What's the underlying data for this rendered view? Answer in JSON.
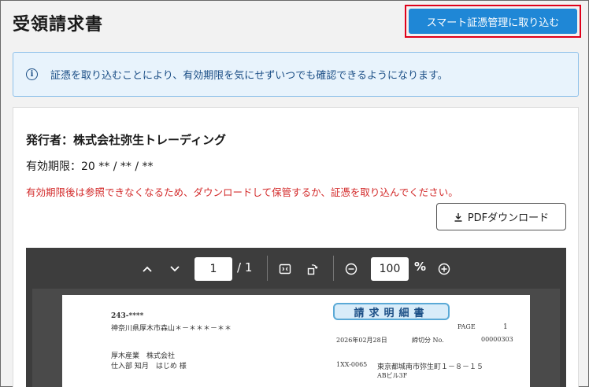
{
  "header": {
    "title": "受領請求書",
    "import_button_label": "スマート証憑管理に取り込む"
  },
  "info": {
    "icon": "info-icon",
    "text": "証憑を取り込むことにより、有効期限を気にせずいつでも確認できるようになります。"
  },
  "card": {
    "issuer": "発行者：株式会社弥生トレーディング",
    "expiry": "有効期限：20 ** / ** / **",
    "warning": "有効期限後は参照できなくなるため、ダウンロードして保管するか、証憑を取り込んでください。",
    "download_button_label": "PDFダウンロード"
  },
  "viewer": {
    "current_page": "1",
    "page_total": "/ 1",
    "zoom_value": "100",
    "zoom_unit": "%"
  },
  "document": {
    "postal_code": "243-****",
    "address": "神奈川県厚木市森山＊－＊＊＊－＊＊",
    "company": "厚木産業　株式会社",
    "recipient": "仕入部 知月　はじめ 様",
    "title": "請求明細書",
    "page_label": "PAGE",
    "page_no": "1",
    "date": "2026年02月28日",
    "closing_label": "締切分 No.",
    "doc_no": "00000303",
    "sender_code": "1XX-0065",
    "sender_address": "東京都城南市弥生町１－８－１５",
    "sender_building": "ABビル3F"
  },
  "colors": {
    "primary": "#1f87d6",
    "info_bg": "#e8f3fc",
    "info_text": "#1c4f86",
    "warning": "#d32b2b",
    "highlight_border": "#e0001a"
  }
}
